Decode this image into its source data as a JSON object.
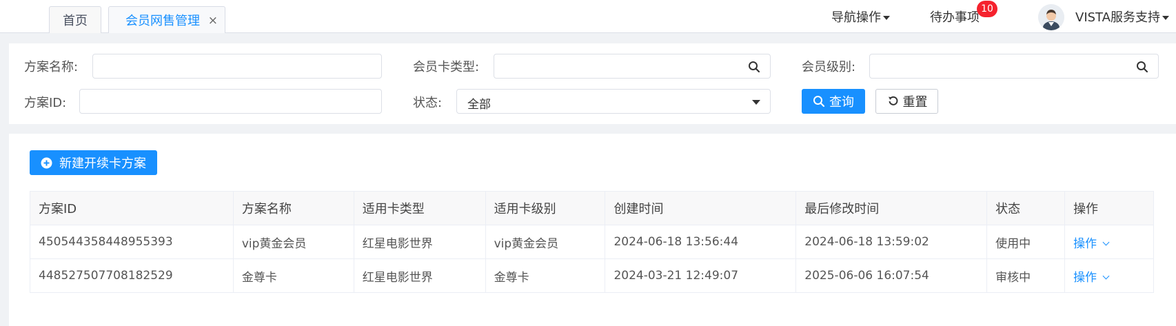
{
  "tabs": [
    {
      "label": "首页"
    },
    {
      "label": "会员网售管理",
      "close": "×"
    }
  ],
  "header": {
    "nav_ops": "导航操作",
    "todo": "待办事项",
    "todo_count": "10",
    "user": "VISTA服务支持"
  },
  "filters": {
    "scheme_name_label": "方案名称:",
    "card_type_label": "会员卡类型:",
    "member_level_label": "会员级别:",
    "scheme_id_label": "方案ID:",
    "status_label": "状态:",
    "status_value": "全部",
    "query_label": "查询",
    "reset_label": "重置"
  },
  "actions": {
    "new_label": "新建开续卡方案"
  },
  "table": {
    "columns": [
      "方案ID",
      "方案名称",
      "适用卡类型",
      "适用卡级别",
      "创建时间",
      "最后修改时间",
      "状态",
      "操作"
    ],
    "rows": [
      [
        "450544358448955393",
        "vip黄金会员",
        "红星电影世界",
        "vip黄金会员",
        "2024-06-18 13:56:44",
        "2024-06-18 13:59:02",
        "使用中",
        "操作"
      ],
      [
        "448527507708182529",
        "金尊卡",
        "红星电影世界",
        "金尊卡",
        "2024-03-21 12:49:07",
        "2025-06-06 16:07:54",
        "审核中",
        "操作"
      ]
    ]
  },
  "colors": {
    "primary": "#1890ff",
    "badge": "#f5222d"
  }
}
